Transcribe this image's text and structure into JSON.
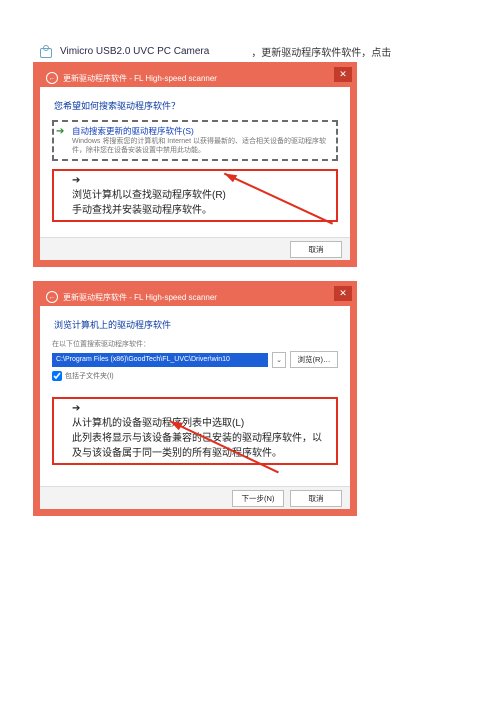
{
  "intro": {
    "device": "Vimicro USB2.0 UVC PC Camera",
    "tail": "，更新驱动程序软件软件，点击"
  },
  "dialog1": {
    "title": "更新驱动程序软件 - FL High-speed scanner",
    "heading": "您希望如何搜索驱动程序软件？",
    "optA": {
      "title": "自动搜索更新的驱动程序软件(S)",
      "sub": "Windows 将搜索您的计算机和 Internet 以获得最新的、适合相关设备的驱动程序软件，除非您在设备安装设置中禁用此功能。"
    },
    "optB": {
      "title": "浏览计算机以查找驱动程序软件(R)",
      "sub": "手动查找并安装驱动程序软件。"
    },
    "cancel": "取消"
  },
  "dialog2": {
    "title": "更新驱动程序软件 - FL High-speed scanner",
    "heading": "浏览计算机上的驱动程序软件",
    "pathLabel": "在以下位置搜索驱动程序软件：",
    "path": "C:\\Program Files (x86)\\GoodTech\\FL_UVC\\Driver\\win10",
    "browse": "浏览(R)…",
    "include": "包括子文件夹(I)",
    "optC": {
      "title": "从计算机的设备驱动程序列表中选取(L)",
      "sub": "此列表将显示与该设备兼容的已安装的驱动程序软件，以及与该设备属于同一类别的所有驱动程序软件。"
    },
    "next": "下一步(N)",
    "cancel": "取消"
  }
}
